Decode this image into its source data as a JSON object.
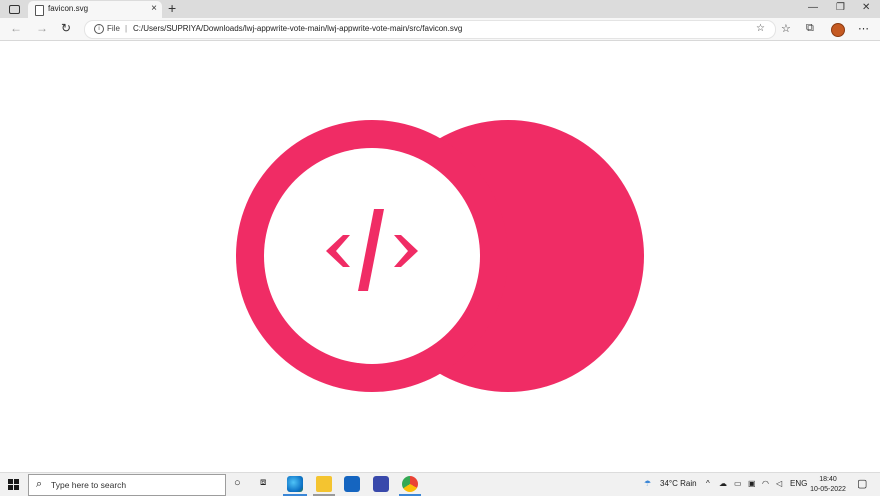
{
  "browser": {
    "tab_title": "favicon.svg",
    "new_tab": "+",
    "tab_close": "×",
    "address": {
      "scheme_label": "File",
      "separator": "|",
      "url": "C:/Users/SUPRIYA/Downloads/lwj-appwrite-vote-main/lwj-appwrite-vote-main/src/favicon.svg"
    },
    "window_controls": {
      "minimize": "—",
      "restore": "❐",
      "close": "✕"
    },
    "nav": {
      "back": "←",
      "forward": "→",
      "refresh": "↻",
      "more": "⋯"
    }
  },
  "page": {
    "logo": {
      "glyph_left": "‹",
      "glyph_slash": "/",
      "glyph_right": "›",
      "accent_color": "#f02c65"
    }
  },
  "taskbar": {
    "search_placeholder": "Type here to search",
    "weather": "34°C  Rain",
    "language": "ENG",
    "time": "18:40",
    "date": "10-05-2022"
  },
  "colors": {
    "accent": "#f02c65",
    "tabbar": "#dcdcdc",
    "toolbar": "#f7f7f7"
  }
}
